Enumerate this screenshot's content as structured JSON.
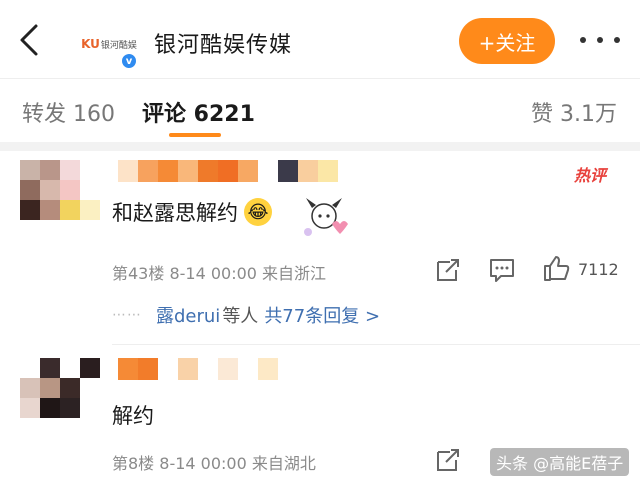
{
  "header": {
    "back_icon": "chevron-left-icon",
    "logo_ku": "KU",
    "logo_cn": "银河酷娱",
    "verified_icon": "verified-badge-icon",
    "title": "银河酷娱传媒",
    "follow_label": "+关注",
    "more_icon": "more-horizontal-icon"
  },
  "tabs": [
    {
      "label": "转发 160",
      "active": false
    },
    {
      "label": "评论 6221",
      "active": true
    },
    {
      "label": "赞 3.1万",
      "active": false
    }
  ],
  "colors": {
    "accent": "#ff8a1a",
    "link": "#3f6fb0",
    "hot": "#e8413c"
  },
  "comments": [
    {
      "hot_badge": "热评",
      "text": "和赵露思解约",
      "emoji": "😂",
      "meta": "第43楼 8-14 00:00 来自浙江",
      "like_count": "7112",
      "replies": {
        "dots": "⋯⋯",
        "user": "露derui",
        "mid": "等人",
        "link": "共77条回复 >"
      }
    },
    {
      "text": "解约",
      "meta": "第8楼 8-14 00:00 来自湖北"
    }
  ],
  "watermark": "头条 @高能E蓓子"
}
